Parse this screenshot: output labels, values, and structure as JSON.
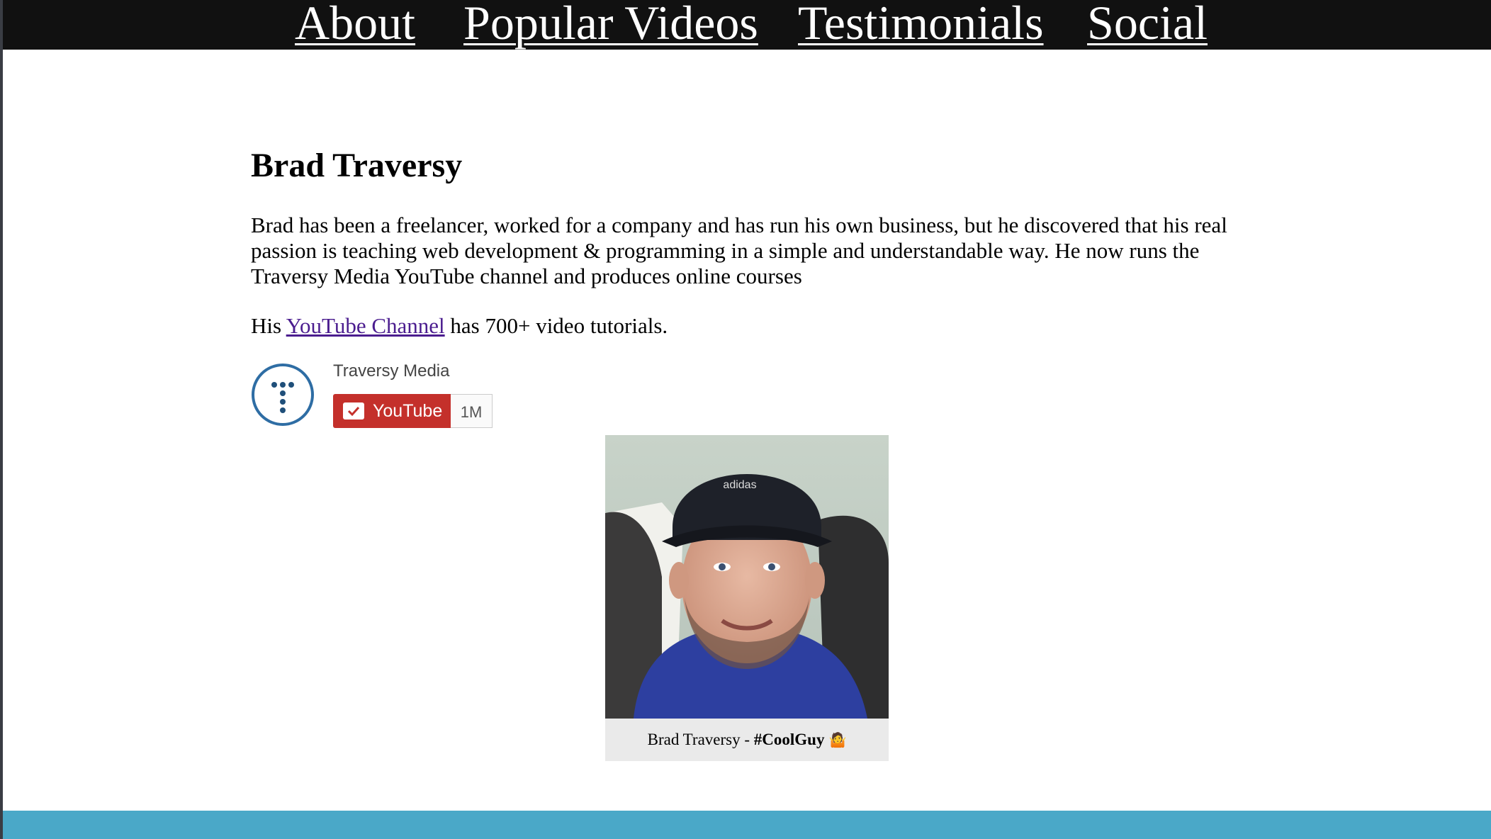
{
  "nav": {
    "about": "About",
    "popular_videos": "Popular Videos",
    "testimonials": "Testimonials",
    "social": "Social"
  },
  "about": {
    "heading": "Brad Traversy",
    "bio": "Brad has been a freelancer, worked for a company and has run his own business, but he discovered that his real passion is teaching web development & programming in a simple and understandable way. He now runs the Traversy Media YouTube channel and produces online courses",
    "channel_prefix": "His",
    "channel_link": "YouTube Channel",
    "channel_suffix": "has 700+ video tutorials."
  },
  "youtube_widget": {
    "channel_name": "Traversy Media",
    "button_label": "YouTube",
    "subscriber_count": "1M",
    "brand_color": "#c4302b"
  },
  "figure": {
    "caption_prefix": "Brad Traversy - ",
    "caption_tag": "#CoolGuy",
    "caption_emoji": "🤷",
    "cap_text": "adidas"
  },
  "colors": {
    "nav_bg": "#111111",
    "footer_bg": "#4aa8c8",
    "link_visited": "#4b1d8f"
  }
}
